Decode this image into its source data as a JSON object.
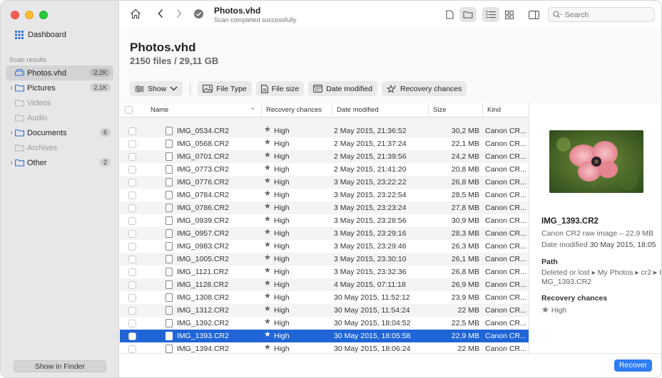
{
  "sidebar": {
    "dashboard_label": "Dashboard",
    "section_label": "Scan results",
    "items": [
      {
        "label": "Photos.vhd",
        "badge": "2,2K",
        "selected": true,
        "chevron": false,
        "dim": false
      },
      {
        "label": "Pictures",
        "badge": "2,1K",
        "selected": false,
        "chevron": true,
        "dim": false
      },
      {
        "label": "Videos",
        "badge": "",
        "selected": false,
        "chevron": false,
        "dim": true
      },
      {
        "label": "Audio",
        "badge": "",
        "selected": false,
        "chevron": false,
        "dim": true
      },
      {
        "label": "Documents",
        "badge": "6",
        "selected": false,
        "chevron": true,
        "dim": false
      },
      {
        "label": "Archives",
        "badge": "",
        "selected": false,
        "chevron": false,
        "dim": true
      },
      {
        "label": "Other",
        "badge": "2",
        "selected": false,
        "chevron": true,
        "dim": false
      }
    ],
    "show_in_finder": "Show in Finder"
  },
  "toolbar": {
    "title": "Photos.vhd",
    "subtitle": "Scan completed successfully",
    "search_placeholder": "Search"
  },
  "header": {
    "title": "Photos.vhd",
    "subtitle": "2150 files / 29,11 GB",
    "filters": {
      "show": "Show",
      "file_type": "File Type",
      "file_size": "File size",
      "date_modified": "Date modified",
      "recovery_chances": "Recovery chances"
    }
  },
  "table": {
    "columns": {
      "name": "Name",
      "recovery": "Recovery chances",
      "date": "Date modified",
      "size": "Size",
      "kind": "Kind"
    },
    "rows": [
      {
        "name": "IMG_0534.CR2",
        "recovery": "High",
        "date": "2 May 2015, 21:36:52",
        "size": "30,2 MB",
        "kind": "Canon CR..."
      },
      {
        "name": "IMG_0568.CR2",
        "recovery": "High",
        "date": "2 May 2015, 21:37:24",
        "size": "22,1 MB",
        "kind": "Canon CR..."
      },
      {
        "name": "IMG_0701.CR2",
        "recovery": "High",
        "date": "2 May 2015, 21:39:56",
        "size": "24,2 MB",
        "kind": "Canon CR..."
      },
      {
        "name": "IMG_0773.CR2",
        "recovery": "High",
        "date": "2 May 2015, 21:41:20",
        "size": "20,8 MB",
        "kind": "Canon CR..."
      },
      {
        "name": "IMG_0776.CR2",
        "recovery": "High",
        "date": "3 May 2015, 23:22:22",
        "size": "26,8 MB",
        "kind": "Canon CR..."
      },
      {
        "name": "IMG_0784.CR2",
        "recovery": "High",
        "date": "3 May 2015, 23:22:54",
        "size": "28,5 MB",
        "kind": "Canon CR..."
      },
      {
        "name": "IMG_0786.CR2",
        "recovery": "High",
        "date": "3 May 2015, 23:23:24",
        "size": "27,8 MB",
        "kind": "Canon CR..."
      },
      {
        "name": "IMG_0939.CR2",
        "recovery": "High",
        "date": "3 May 2015, 23:28:56",
        "size": "30,9 MB",
        "kind": "Canon CR..."
      },
      {
        "name": "IMG_0957.CR2",
        "recovery": "High",
        "date": "3 May 2015, 23:29:16",
        "size": "28,3 MB",
        "kind": "Canon CR..."
      },
      {
        "name": "IMG_0983.CR2",
        "recovery": "High",
        "date": "3 May 2015, 23:29:46",
        "size": "26,3 MB",
        "kind": "Canon CR..."
      },
      {
        "name": "IMG_1005.CR2",
        "recovery": "High",
        "date": "3 May 2015, 23:30:10",
        "size": "26,1 MB",
        "kind": "Canon CR..."
      },
      {
        "name": "IMG_1121.CR2",
        "recovery": "High",
        "date": "3 May 2015, 23:32:36",
        "size": "26,8 MB",
        "kind": "Canon CR..."
      },
      {
        "name": "IMG_1128.CR2",
        "recovery": "High",
        "date": "4 May 2015, 07:11:18",
        "size": "26,9 MB",
        "kind": "Canon CR..."
      },
      {
        "name": "IMG_1308.CR2",
        "recovery": "High",
        "date": "30 May 2015, 11:52:12",
        "size": "23,9 MB",
        "kind": "Canon CR..."
      },
      {
        "name": "IMG_1312.CR2",
        "recovery": "High",
        "date": "30 May 2015, 11:54:24",
        "size": "22 MB",
        "kind": "Canon CR..."
      },
      {
        "name": "IMG_1392.CR2",
        "recovery": "High",
        "date": "30 May 2015, 18:04:52",
        "size": "22,5 MB",
        "kind": "Canon CR..."
      },
      {
        "name": "IMG_1393.CR2",
        "recovery": "High",
        "date": "30 May 2015, 18:05:58",
        "size": "22,9 MB",
        "kind": "Canon CR...",
        "selected": true
      },
      {
        "name": "IMG_1394.CR2",
        "recovery": "High",
        "date": "30 May 2015, 18:06:24",
        "size": "22 MB",
        "kind": "Canon CR..."
      }
    ]
  },
  "preview": {
    "name": "IMG_1393.CR2",
    "meta": "Canon CR2 raw image – 22,9 MB",
    "date_label": "Date modified",
    "date_value": "30 May 2015, 18:05",
    "path_heading": "Path",
    "path_line1": "Deleted or lost ▸ My Photos ▸ cr2 ▸ I",
    "path_line2": "MG_1393.CR2",
    "recovery_heading": "Recovery chances",
    "recovery_value": "High"
  },
  "footer": {
    "recover_label": "Recover"
  },
  "colors": {
    "accent": "#1f65d6",
    "recover_button": "#2e7cf6"
  }
}
